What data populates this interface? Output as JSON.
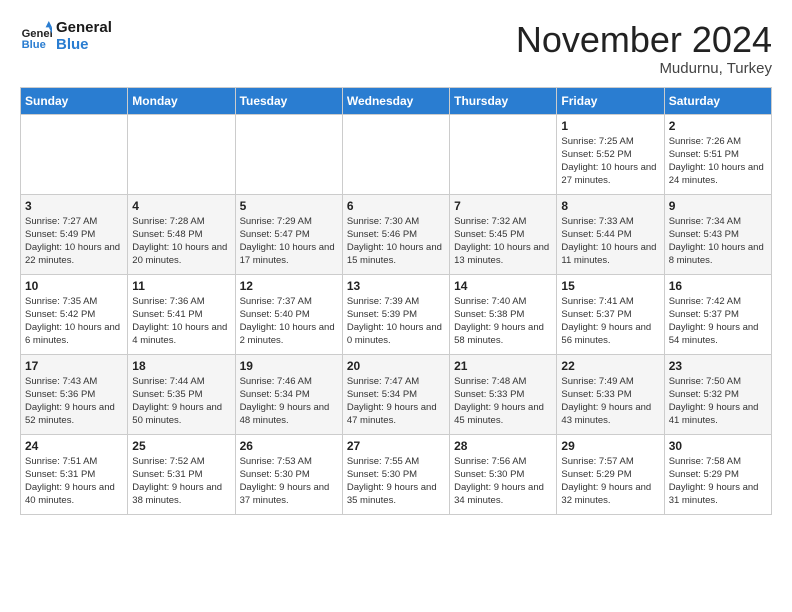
{
  "logo": {
    "line1": "General",
    "line2": "Blue"
  },
  "header": {
    "month": "November 2024",
    "location": "Mudurnu, Turkey"
  },
  "weekdays": [
    "Sunday",
    "Monday",
    "Tuesday",
    "Wednesday",
    "Thursday",
    "Friday",
    "Saturday"
  ],
  "weeks": [
    [
      {
        "day": "",
        "info": ""
      },
      {
        "day": "",
        "info": ""
      },
      {
        "day": "",
        "info": ""
      },
      {
        "day": "",
        "info": ""
      },
      {
        "day": "",
        "info": ""
      },
      {
        "day": "1",
        "info": "Sunrise: 7:25 AM\nSunset: 5:52 PM\nDaylight: 10 hours and 27 minutes."
      },
      {
        "day": "2",
        "info": "Sunrise: 7:26 AM\nSunset: 5:51 PM\nDaylight: 10 hours and 24 minutes."
      }
    ],
    [
      {
        "day": "3",
        "info": "Sunrise: 7:27 AM\nSunset: 5:49 PM\nDaylight: 10 hours and 22 minutes."
      },
      {
        "day": "4",
        "info": "Sunrise: 7:28 AM\nSunset: 5:48 PM\nDaylight: 10 hours and 20 minutes."
      },
      {
        "day": "5",
        "info": "Sunrise: 7:29 AM\nSunset: 5:47 PM\nDaylight: 10 hours and 17 minutes."
      },
      {
        "day": "6",
        "info": "Sunrise: 7:30 AM\nSunset: 5:46 PM\nDaylight: 10 hours and 15 minutes."
      },
      {
        "day": "7",
        "info": "Sunrise: 7:32 AM\nSunset: 5:45 PM\nDaylight: 10 hours and 13 minutes."
      },
      {
        "day": "8",
        "info": "Sunrise: 7:33 AM\nSunset: 5:44 PM\nDaylight: 10 hours and 11 minutes."
      },
      {
        "day": "9",
        "info": "Sunrise: 7:34 AM\nSunset: 5:43 PM\nDaylight: 10 hours and 8 minutes."
      }
    ],
    [
      {
        "day": "10",
        "info": "Sunrise: 7:35 AM\nSunset: 5:42 PM\nDaylight: 10 hours and 6 minutes."
      },
      {
        "day": "11",
        "info": "Sunrise: 7:36 AM\nSunset: 5:41 PM\nDaylight: 10 hours and 4 minutes."
      },
      {
        "day": "12",
        "info": "Sunrise: 7:37 AM\nSunset: 5:40 PM\nDaylight: 10 hours and 2 minutes."
      },
      {
        "day": "13",
        "info": "Sunrise: 7:39 AM\nSunset: 5:39 PM\nDaylight: 10 hours and 0 minutes."
      },
      {
        "day": "14",
        "info": "Sunrise: 7:40 AM\nSunset: 5:38 PM\nDaylight: 9 hours and 58 minutes."
      },
      {
        "day": "15",
        "info": "Sunrise: 7:41 AM\nSunset: 5:37 PM\nDaylight: 9 hours and 56 minutes."
      },
      {
        "day": "16",
        "info": "Sunrise: 7:42 AM\nSunset: 5:37 PM\nDaylight: 9 hours and 54 minutes."
      }
    ],
    [
      {
        "day": "17",
        "info": "Sunrise: 7:43 AM\nSunset: 5:36 PM\nDaylight: 9 hours and 52 minutes."
      },
      {
        "day": "18",
        "info": "Sunrise: 7:44 AM\nSunset: 5:35 PM\nDaylight: 9 hours and 50 minutes."
      },
      {
        "day": "19",
        "info": "Sunrise: 7:46 AM\nSunset: 5:34 PM\nDaylight: 9 hours and 48 minutes."
      },
      {
        "day": "20",
        "info": "Sunrise: 7:47 AM\nSunset: 5:34 PM\nDaylight: 9 hours and 47 minutes."
      },
      {
        "day": "21",
        "info": "Sunrise: 7:48 AM\nSunset: 5:33 PM\nDaylight: 9 hours and 45 minutes."
      },
      {
        "day": "22",
        "info": "Sunrise: 7:49 AM\nSunset: 5:33 PM\nDaylight: 9 hours and 43 minutes."
      },
      {
        "day": "23",
        "info": "Sunrise: 7:50 AM\nSunset: 5:32 PM\nDaylight: 9 hours and 41 minutes."
      }
    ],
    [
      {
        "day": "24",
        "info": "Sunrise: 7:51 AM\nSunset: 5:31 PM\nDaylight: 9 hours and 40 minutes."
      },
      {
        "day": "25",
        "info": "Sunrise: 7:52 AM\nSunset: 5:31 PM\nDaylight: 9 hours and 38 minutes."
      },
      {
        "day": "26",
        "info": "Sunrise: 7:53 AM\nSunset: 5:30 PM\nDaylight: 9 hours and 37 minutes."
      },
      {
        "day": "27",
        "info": "Sunrise: 7:55 AM\nSunset: 5:30 PM\nDaylight: 9 hours and 35 minutes."
      },
      {
        "day": "28",
        "info": "Sunrise: 7:56 AM\nSunset: 5:30 PM\nDaylight: 9 hours and 34 minutes."
      },
      {
        "day": "29",
        "info": "Sunrise: 7:57 AM\nSunset: 5:29 PM\nDaylight: 9 hours and 32 minutes."
      },
      {
        "day": "30",
        "info": "Sunrise: 7:58 AM\nSunset: 5:29 PM\nDaylight: 9 hours and 31 minutes."
      }
    ]
  ]
}
